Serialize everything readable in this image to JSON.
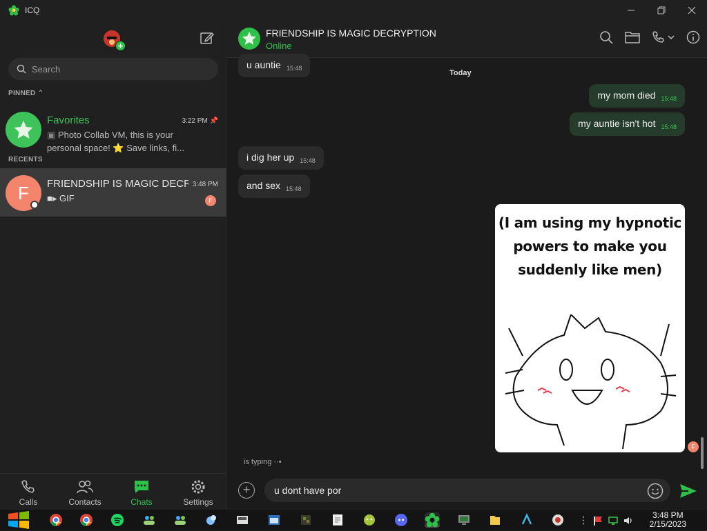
{
  "window": {
    "app_title": "ICQ",
    "controls": [
      "minimize",
      "restore",
      "close"
    ]
  },
  "sidebar": {
    "search_placeholder": "Search",
    "pinned_label": "PINNED",
    "recents_label": "RECENTS",
    "pinned": [
      {
        "name": "Favorites",
        "time": "3:22 PM",
        "preview": "Photo Collab VM, this is your personal space! ⭐ Save links, fi..."
      }
    ],
    "recents": [
      {
        "name": "FRIENDSHIP IS MAGIC DECRY...",
        "initial": "F",
        "time": "3:48 PM",
        "preview": "GIF",
        "unread_initial": "F"
      }
    ],
    "nav": [
      {
        "label": "Calls",
        "icon": "phone-icon"
      },
      {
        "label": "Contacts",
        "icon": "contacts-icon"
      },
      {
        "label": "Chats",
        "icon": "chats-icon",
        "active": true
      },
      {
        "label": "Settings",
        "icon": "gear-icon"
      }
    ]
  },
  "chat": {
    "title": "FRIENDSHIP IS MAGIC DECRYPTION",
    "status": "Online",
    "date_divider": "Today",
    "messages": [
      {
        "dir": "in",
        "text": "u auntie",
        "time": "15:48"
      },
      {
        "dir": "out",
        "text": "my mom died",
        "time": "15:48"
      },
      {
        "dir": "out",
        "text": "my auntie isn't hot",
        "time": "15:48"
      },
      {
        "dir": "in",
        "text": "i dig her up",
        "time": "15:48"
      },
      {
        "dir": "in",
        "text": "and sex",
        "time": "15:48"
      }
    ],
    "gif_caption": "(I am using my hypnotic powers to make you suddenly like men)",
    "read_avatar_initial": "F",
    "typing": "is typing",
    "composer_value": "u dont have por"
  },
  "taskbar": {
    "time": "3:48 PM",
    "date": "2/15/2023",
    "apps": [
      "chrome",
      "chrome",
      "spotify",
      "users",
      "users",
      "app",
      "app",
      "window",
      "minecraft",
      "editor",
      "android",
      "discord",
      "icq",
      "monitor",
      "files",
      "app",
      "app"
    ]
  },
  "colors": {
    "accent": "#2fc04a",
    "out_bubble": "#253c2c",
    "in_bubble": "#2b2b2b",
    "active_row": "#3a3a3a"
  }
}
